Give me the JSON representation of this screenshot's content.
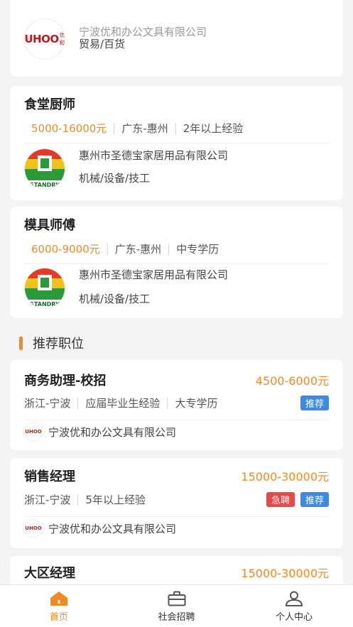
{
  "top_card": {
    "company_name_partial": "宁波优和办公文具有限公司",
    "industry": "贸易/百货",
    "logo_text": "UHOO",
    "logo_sub": "优和"
  },
  "jobs": [
    {
      "title": "食堂厨师",
      "salary": "5000-16000元",
      "location": "广东-惠州",
      "requirement": "2年以上经验",
      "company": "惠州市圣德宝家居用品有限公司",
      "industry": "机械/设备/技工",
      "logo_text": "STANDRY"
    },
    {
      "title": "模具师傅",
      "salary": "6000-9000元",
      "location": "广东-惠州",
      "requirement": "中专学历",
      "company": "惠州市圣德宝家居用品有限公司",
      "industry": "机械/设备/技工",
      "logo_text": "STANDRY"
    }
  ],
  "section": {
    "title": "推荐职位"
  },
  "recommended": [
    {
      "title": "商务助理-校招",
      "salary": "4500-6000元",
      "location": "浙江-宁波",
      "experience": "应届毕业生经验",
      "education": "大专学历",
      "tags": [
        "推荐"
      ],
      "company": "宁波优和办公文具有限公司"
    },
    {
      "title": "销售经理",
      "salary": "15000-30000元",
      "location": "浙江-宁波",
      "experience": "5年以上经验",
      "tags": [
        "急聘",
        "推荐"
      ],
      "company": "宁波优和办公文具有限公司"
    },
    {
      "title": "大区经理",
      "salary": "15000-30000元"
    }
  ],
  "tabbar": {
    "home": "首页",
    "social": "社会招聘",
    "profile": "个人中心"
  },
  "colors": {
    "accent": "#f08a24",
    "tag_blue": "#3c8be0",
    "tag_red": "#e84848"
  }
}
